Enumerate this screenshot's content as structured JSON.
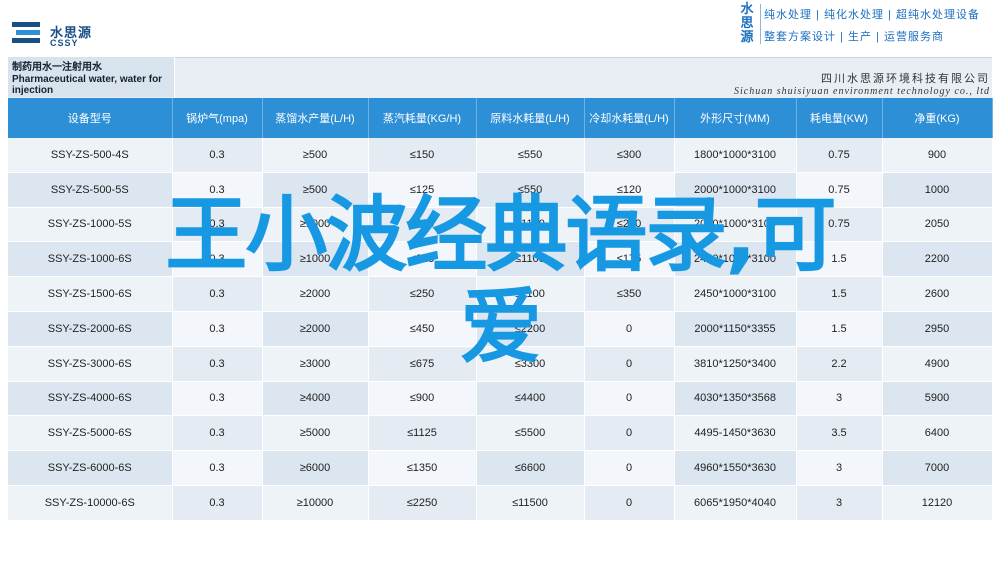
{
  "brand": {
    "name_cn": "水思源",
    "name_en": "CSSY"
  },
  "topright": {
    "vertical": "水思源",
    "line1": "纯水处理 | 纯化水处理 | 超纯水处理设备",
    "line2": "整套方案设计 | 生产 | 运营服务商"
  },
  "title": {
    "cn": "制药用水一注射用水",
    "en1": "Pharmaceutical water, water for",
    "en2": "injection"
  },
  "company": {
    "cn": "四川水思源环境科技有限公司",
    "en": "Sichuan shuisiyuan environment technology co., ltd"
  },
  "table": {
    "headers": [
      "设备型号",
      "锅炉气(mpa)",
      "蒸馏水产量(L/H)",
      "蒸汽耗量(KG/H)",
      "原料水耗量(L/H)",
      "冷却水耗量(L/H)",
      "外形尺寸(MM)",
      "耗电量(KW)",
      "净重(KG)"
    ],
    "rows": [
      [
        "SSY-ZS-500-4S",
        "0.3",
        "≥500",
        "≤150",
        "≤550",
        "≤300",
        "1800*1000*3100",
        "0.75",
        "900"
      ],
      [
        "SSY-ZS-500-5S",
        "0.3",
        "≥500",
        "≤125",
        "≤550",
        "≤120",
        "2000*1000*3100",
        "0.75",
        "1000"
      ],
      [
        "SSY-ZS-1000-5S",
        "0.3",
        "≥1000",
        "≤250",
        "≤1100",
        "≤240",
        "2000*1000*3100",
        "0.75",
        "2050"
      ],
      [
        "SSY-ZS-1000-6S",
        "0.3",
        "≥1000",
        "≤225",
        "≤1100",
        "≤175",
        "2450*1000*3100",
        "1.5",
        "2200"
      ],
      [
        "SSY-ZS-1500-6S",
        "0.3",
        "≥2000",
        "≤250",
        "≤1100",
        "≤350",
        "2450*1000*3100",
        "1.5",
        "2600"
      ],
      [
        "SSY-ZS-2000-6S",
        "0.3",
        "≥2000",
        "≤450",
        "≤2200",
        "0",
        "2000*1150*3355",
        "1.5",
        "2950"
      ],
      [
        "SSY-ZS-3000-6S",
        "0.3",
        "≥3000",
        "≤675",
        "≤3300",
        "0",
        "3810*1250*3400",
        "2.2",
        "4900"
      ],
      [
        "SSY-ZS-4000-6S",
        "0.3",
        "≥4000",
        "≤900",
        "≤4400",
        "0",
        "4030*1350*3568",
        "3",
        "5900"
      ],
      [
        "SSY-ZS-5000-6S",
        "0.3",
        "≥5000",
        "≤1125",
        "≤5500",
        "0",
        "4495-1450*3630",
        "3.5",
        "6400"
      ],
      [
        "SSY-ZS-6000-6S",
        "0.3",
        "≥6000",
        "≤1350",
        "≤6600",
        "0",
        "4960*1550*3630",
        "3",
        "7000"
      ],
      [
        "SSY-ZS-10000-6S",
        "0.3",
        "≥10000",
        "≤2250",
        "≤11500",
        "0",
        "6065*1950*4040",
        "3",
        "12120"
      ]
    ]
  },
  "overlay": {
    "line1": "王小波经典语录,可",
    "line2": "爱"
  }
}
